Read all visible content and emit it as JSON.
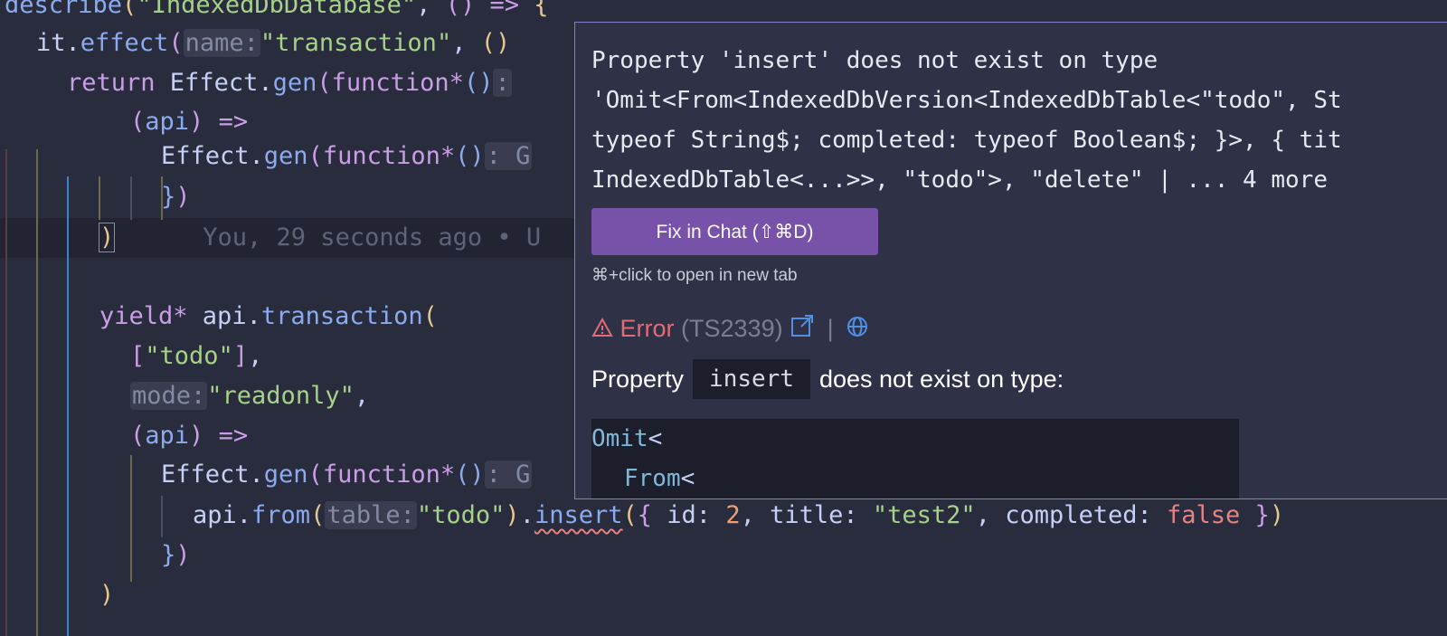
{
  "editor": {
    "colors": {
      "background": "#292c3d",
      "popup_border": "#8a7bc8",
      "button": "#7851a9",
      "error": "#e06c75"
    },
    "l0": {
      "a": "describe",
      "b": "(",
      "c": "\"IndexedDbDatabase\"",
      "d": ", ",
      "e": "()",
      "f": " => ",
      "g": "{"
    },
    "l1": {
      "a": "it",
      "b": ".",
      "c": "effect",
      "d": "(",
      "hint": "name:",
      "e": "\"transaction\"",
      "f": ", ",
      "g": "()"
    },
    "l2": {
      "a": "return",
      "b": " Effect.",
      "c": "gen",
      "d": "(",
      "e": "function*",
      "f": "()",
      "g": ":"
    },
    "l3": {
      "a": "(",
      "b": "api",
      "c": ")",
      "d": " =>"
    },
    "l4": {
      "a": "Effect.",
      "b": "gen",
      "c": "(",
      "d": "function*",
      "e": "()",
      "hint": ": G"
    },
    "l5": {
      "a": "}",
      "b": ")"
    },
    "l6": {
      "a": ")",
      "blame": "You, 29 seconds ago • U"
    },
    "l8": {
      "a": "yield*",
      "b": " api.",
      "c": "transaction",
      "d": "("
    },
    "l9": {
      "a": "[",
      "b": "\"todo\"",
      "c": "]",
      "d": ","
    },
    "l10": {
      "hint": "mode:",
      "a": "\"readonly\"",
      "b": ","
    },
    "l11": {
      "a": "(",
      "b": "api",
      "c": ")",
      "d": " =>"
    },
    "l12": {
      "a": "Effect.",
      "b": "gen",
      "c": "(",
      "d": "function*",
      "e": "()",
      "hint": ": G"
    },
    "l13": {
      "a": "api.",
      "b": "from",
      "c": "(",
      "hint": "table:",
      "d": "\"todo\"",
      "e": ")",
      "f": ".",
      "g": "insert",
      "h": "(",
      "i": "{",
      "j": " id: ",
      "k": "2",
      "l": ", title: ",
      "m": "\"test2\"",
      "n": ", completed: ",
      "o": "false",
      "p": " }",
      "q": ")"
    },
    "l14": {
      "a": "}",
      "b": ")"
    },
    "l15": {
      "a": ")"
    }
  },
  "popup": {
    "type_lines": [
      "Property 'insert' does not exist on type",
      "'Omit<From<IndexedDbVersion<IndexedDbTable<\"todo\", St",
      "typeof String$; completed: typeof Boolean$; }>, { tit",
      "IndexedDbTable<...>>, \"todo\">, \"delete\" | ... 4 more"
    ],
    "fix_button": "Fix in Chat (⇧⌘D)",
    "open_hint": "⌘+click to open in new tab",
    "error_label": "Error",
    "error_code": "(TS2339)",
    "separator": "|",
    "message_prefix": "Property",
    "message_code": "insert",
    "message_suffix": "does not exist on type:",
    "code_lines": [
      "Omit<",
      "From<"
    ],
    "icons": [
      "warning-icon",
      "external-link-icon",
      "globe-icon"
    ]
  }
}
